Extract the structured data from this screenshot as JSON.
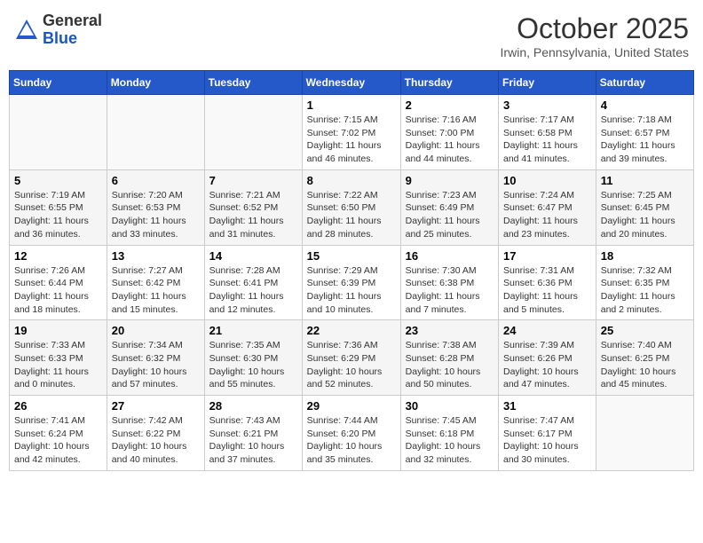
{
  "header": {
    "logo_line1": "General",
    "logo_line2": "Blue",
    "month": "October 2025",
    "location": "Irwin, Pennsylvania, United States"
  },
  "days_of_week": [
    "Sunday",
    "Monday",
    "Tuesday",
    "Wednesday",
    "Thursday",
    "Friday",
    "Saturday"
  ],
  "weeks": [
    [
      {
        "day": "",
        "info": ""
      },
      {
        "day": "",
        "info": ""
      },
      {
        "day": "",
        "info": ""
      },
      {
        "day": "1",
        "info": "Sunrise: 7:15 AM\nSunset: 7:02 PM\nDaylight: 11 hours\nand 46 minutes."
      },
      {
        "day": "2",
        "info": "Sunrise: 7:16 AM\nSunset: 7:00 PM\nDaylight: 11 hours\nand 44 minutes."
      },
      {
        "day": "3",
        "info": "Sunrise: 7:17 AM\nSunset: 6:58 PM\nDaylight: 11 hours\nand 41 minutes."
      },
      {
        "day": "4",
        "info": "Sunrise: 7:18 AM\nSunset: 6:57 PM\nDaylight: 11 hours\nand 39 minutes."
      }
    ],
    [
      {
        "day": "5",
        "info": "Sunrise: 7:19 AM\nSunset: 6:55 PM\nDaylight: 11 hours\nand 36 minutes."
      },
      {
        "day": "6",
        "info": "Sunrise: 7:20 AM\nSunset: 6:53 PM\nDaylight: 11 hours\nand 33 minutes."
      },
      {
        "day": "7",
        "info": "Sunrise: 7:21 AM\nSunset: 6:52 PM\nDaylight: 11 hours\nand 31 minutes."
      },
      {
        "day": "8",
        "info": "Sunrise: 7:22 AM\nSunset: 6:50 PM\nDaylight: 11 hours\nand 28 minutes."
      },
      {
        "day": "9",
        "info": "Sunrise: 7:23 AM\nSunset: 6:49 PM\nDaylight: 11 hours\nand 25 minutes."
      },
      {
        "day": "10",
        "info": "Sunrise: 7:24 AM\nSunset: 6:47 PM\nDaylight: 11 hours\nand 23 minutes."
      },
      {
        "day": "11",
        "info": "Sunrise: 7:25 AM\nSunset: 6:45 PM\nDaylight: 11 hours\nand 20 minutes."
      }
    ],
    [
      {
        "day": "12",
        "info": "Sunrise: 7:26 AM\nSunset: 6:44 PM\nDaylight: 11 hours\nand 18 minutes."
      },
      {
        "day": "13",
        "info": "Sunrise: 7:27 AM\nSunset: 6:42 PM\nDaylight: 11 hours\nand 15 minutes."
      },
      {
        "day": "14",
        "info": "Sunrise: 7:28 AM\nSunset: 6:41 PM\nDaylight: 11 hours\nand 12 minutes."
      },
      {
        "day": "15",
        "info": "Sunrise: 7:29 AM\nSunset: 6:39 PM\nDaylight: 11 hours\nand 10 minutes."
      },
      {
        "day": "16",
        "info": "Sunrise: 7:30 AM\nSunset: 6:38 PM\nDaylight: 11 hours\nand 7 minutes."
      },
      {
        "day": "17",
        "info": "Sunrise: 7:31 AM\nSunset: 6:36 PM\nDaylight: 11 hours\nand 5 minutes."
      },
      {
        "day": "18",
        "info": "Sunrise: 7:32 AM\nSunset: 6:35 PM\nDaylight: 11 hours\nand 2 minutes."
      }
    ],
    [
      {
        "day": "19",
        "info": "Sunrise: 7:33 AM\nSunset: 6:33 PM\nDaylight: 11 hours\nand 0 minutes."
      },
      {
        "day": "20",
        "info": "Sunrise: 7:34 AM\nSunset: 6:32 PM\nDaylight: 10 hours\nand 57 minutes."
      },
      {
        "day": "21",
        "info": "Sunrise: 7:35 AM\nSunset: 6:30 PM\nDaylight: 10 hours\nand 55 minutes."
      },
      {
        "day": "22",
        "info": "Sunrise: 7:36 AM\nSunset: 6:29 PM\nDaylight: 10 hours\nand 52 minutes."
      },
      {
        "day": "23",
        "info": "Sunrise: 7:38 AM\nSunset: 6:28 PM\nDaylight: 10 hours\nand 50 minutes."
      },
      {
        "day": "24",
        "info": "Sunrise: 7:39 AM\nSunset: 6:26 PM\nDaylight: 10 hours\nand 47 minutes."
      },
      {
        "day": "25",
        "info": "Sunrise: 7:40 AM\nSunset: 6:25 PM\nDaylight: 10 hours\nand 45 minutes."
      }
    ],
    [
      {
        "day": "26",
        "info": "Sunrise: 7:41 AM\nSunset: 6:24 PM\nDaylight: 10 hours\nand 42 minutes."
      },
      {
        "day": "27",
        "info": "Sunrise: 7:42 AM\nSunset: 6:22 PM\nDaylight: 10 hours\nand 40 minutes."
      },
      {
        "day": "28",
        "info": "Sunrise: 7:43 AM\nSunset: 6:21 PM\nDaylight: 10 hours\nand 37 minutes."
      },
      {
        "day": "29",
        "info": "Sunrise: 7:44 AM\nSunset: 6:20 PM\nDaylight: 10 hours\nand 35 minutes."
      },
      {
        "day": "30",
        "info": "Sunrise: 7:45 AM\nSunset: 6:18 PM\nDaylight: 10 hours\nand 32 minutes."
      },
      {
        "day": "31",
        "info": "Sunrise: 7:47 AM\nSunset: 6:17 PM\nDaylight: 10 hours\nand 30 minutes."
      },
      {
        "day": "",
        "info": ""
      }
    ]
  ]
}
